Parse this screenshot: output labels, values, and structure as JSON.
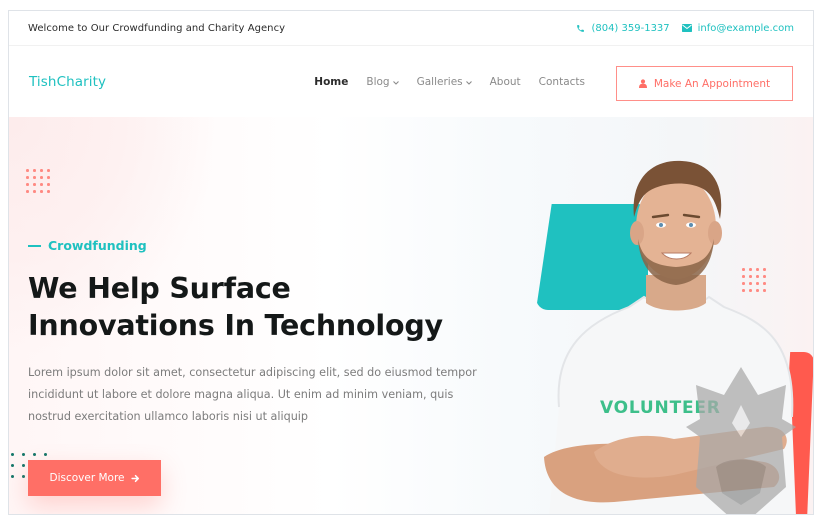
{
  "topbar": {
    "welcome": "Welcome to Our Crowdfunding and Charity Agency",
    "phone": "(804) 359-1337",
    "email": "info@example.com",
    "phone_icon": "phone-icon",
    "email_icon": "envelope-icon"
  },
  "navbar": {
    "logo": "TishCharity",
    "items": [
      {
        "label": "Home",
        "active": true,
        "dropdown": false
      },
      {
        "label": "Blog",
        "active": false,
        "dropdown": true
      },
      {
        "label": "Galleries",
        "active": false,
        "dropdown": true
      },
      {
        "label": "About",
        "active": false,
        "dropdown": false
      },
      {
        "label": "Contacts",
        "active": false,
        "dropdown": false
      }
    ],
    "dropdown_glyph": "⌄",
    "appointment_button": "Make An Appointment",
    "appointment_icon": "user-icon"
  },
  "hero": {
    "kicker": "Crowdfunding",
    "headline_line1": "We Help Surface",
    "headline_line2": "Innovations In Technology",
    "lead": "Lorem ipsum dolor sit amet, consectetur adipiscing elit, sed do eiusmod tempor incididunt ut labore et dolore magna aliqua. Ut enim ad minim veniam, quis nostrud exercitation ullamco laboris nisi ut aliquip",
    "cta_label": "Discover More",
    "cta_icon": "arrow-right-icon",
    "shirt_text": "VOLUNTEER"
  },
  "colors": {
    "accent_teal": "#1fc1c0",
    "accent_coral": "#ff6f66",
    "heading": "#141818",
    "body_text": "#7c7c7c"
  }
}
